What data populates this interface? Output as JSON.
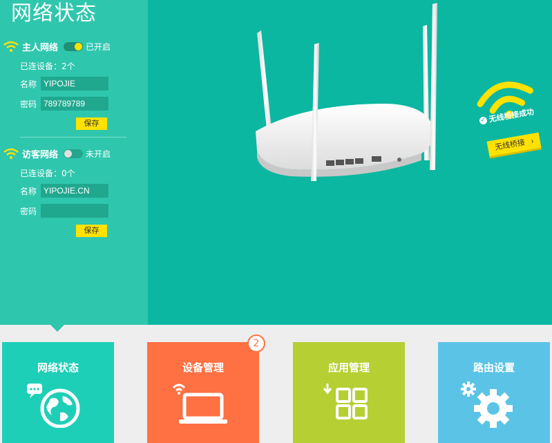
{
  "page_title": "网络状态",
  "main_network": {
    "name": "主人网络",
    "toggle_state": "已开启",
    "connected_devices": "已连设备：2个",
    "ssid_label": "名称",
    "ssid_value": "YIPOJIE",
    "password_label": "密码",
    "password_value": "789789789",
    "save_label": "保存"
  },
  "guest_network": {
    "name": "访客网络",
    "toggle_state": "未开启",
    "connected_devices": "已连设备：0个",
    "ssid_label": "名称",
    "ssid_value": "YIPOJIE.CN",
    "password_label": "密码",
    "password_value": "",
    "save_label": "保存"
  },
  "bridge": {
    "status": "无线桥接成功",
    "button_label": "无线桥接"
  },
  "tiles": [
    {
      "label": "网络状态",
      "color": "#1ecfb8",
      "icon": "globe-chat-icon"
    },
    {
      "label": "设备管理",
      "color": "#ff7043",
      "icon": "laptop-wifi-icon",
      "badge": "2"
    },
    {
      "label": "应用管理",
      "color": "#b6cf33",
      "icon": "apps-grid-icon"
    },
    {
      "label": "路由设置",
      "color": "#5bc4e6",
      "icon": "gears-icon"
    }
  ],
  "colors": {
    "top_background": "#0bb7a0",
    "sidebar": "#2fc6ae",
    "accent_yellow": "#ffe200"
  }
}
